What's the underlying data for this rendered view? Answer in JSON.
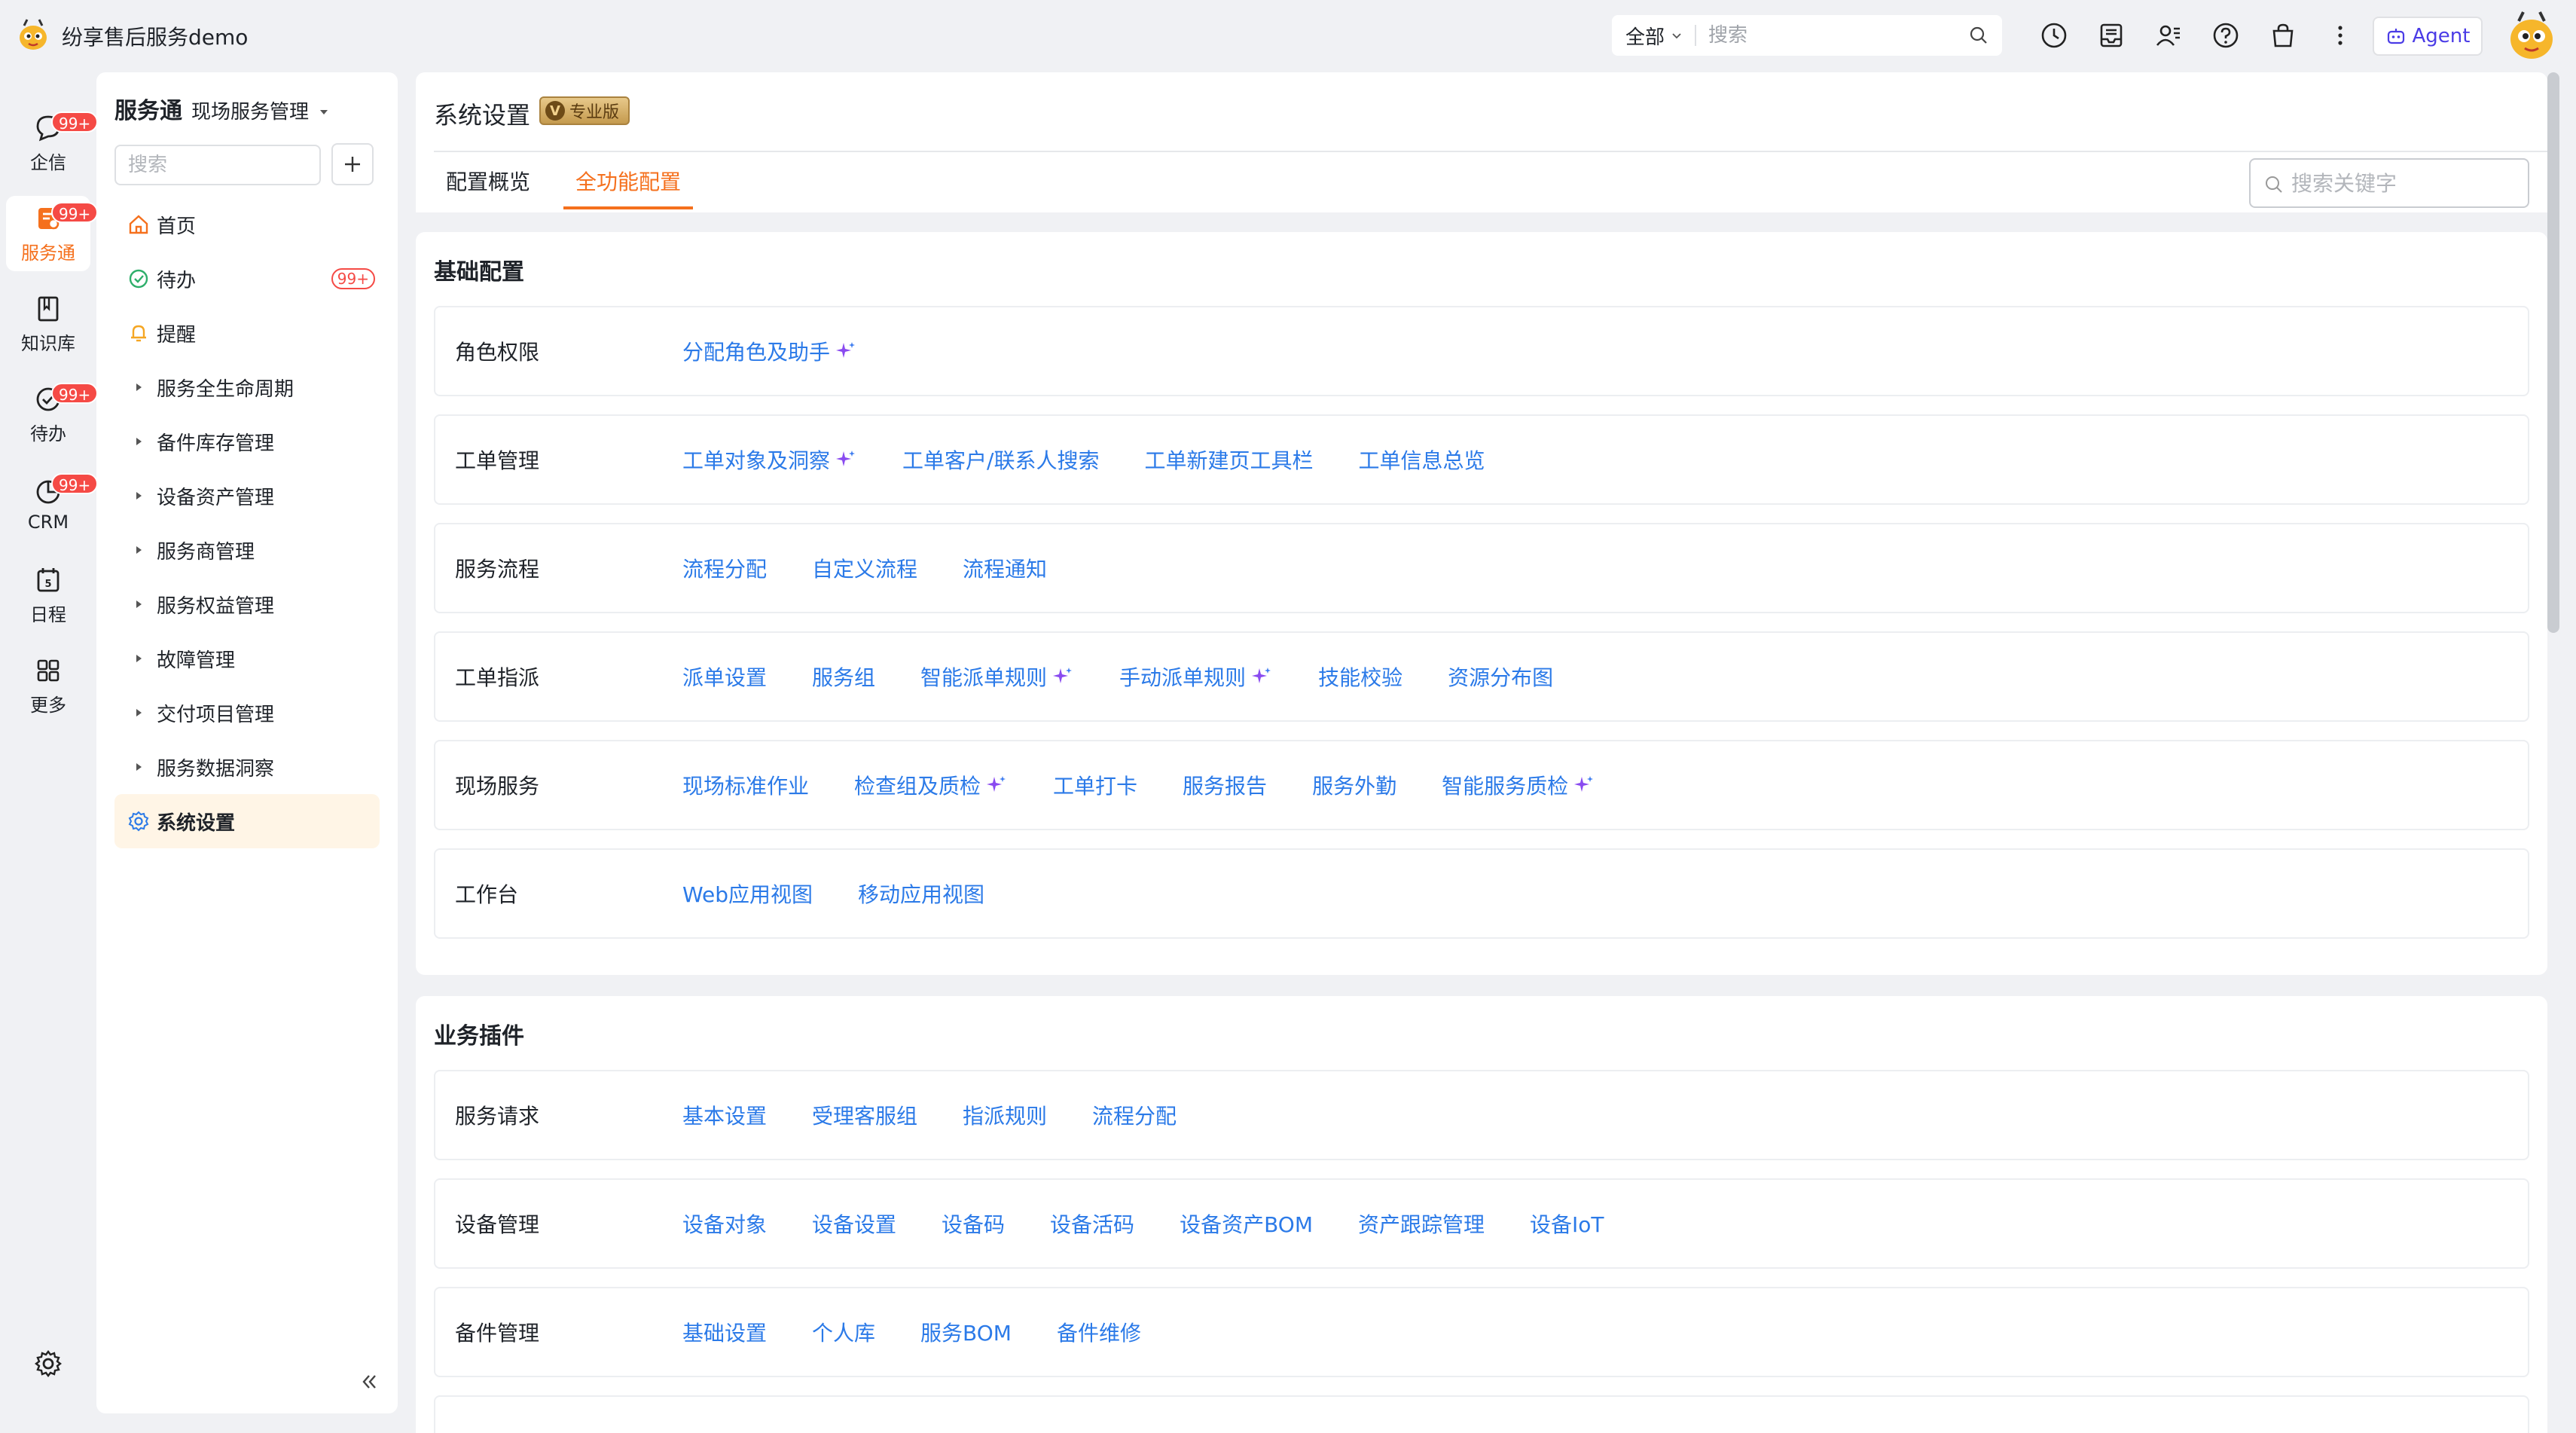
{
  "app": {
    "title": "纷享售后服务demo"
  },
  "topbar": {
    "search_scope": "全部",
    "search_placeholder": "搜索",
    "agent_label": "Agent"
  },
  "rail": {
    "items": [
      {
        "label": "企信",
        "badge": "99+"
      },
      {
        "label": "服务通",
        "badge": "99+"
      },
      {
        "label": "知识库",
        "badge": ""
      },
      {
        "label": "待办",
        "badge": "99+"
      },
      {
        "label": "CRM",
        "badge": "99+"
      },
      {
        "label": "日程",
        "badge": ""
      },
      {
        "label": "更多",
        "badge": ""
      }
    ]
  },
  "nav": {
    "title": "服务通",
    "subtitle": "现场服务管理",
    "search_placeholder": "搜索",
    "items": [
      {
        "label": "首页"
      },
      {
        "label": "待办",
        "badge": "99+"
      },
      {
        "label": "提醒"
      },
      {
        "label": "服务全生命周期"
      },
      {
        "label": "备件库存管理"
      },
      {
        "label": "设备资产管理"
      },
      {
        "label": "服务商管理"
      },
      {
        "label": "服务权益管理"
      },
      {
        "label": "故障管理"
      },
      {
        "label": "交付项目管理"
      },
      {
        "label": "服务数据洞察"
      },
      {
        "label": "系统设置"
      }
    ]
  },
  "main": {
    "title": "系统设置",
    "edition_badge": "专业版",
    "tabs": [
      {
        "label": "配置概览"
      },
      {
        "label": "全功能配置"
      }
    ],
    "keyword_placeholder": "搜索关键字",
    "sections": [
      {
        "title": "基础配置",
        "rows": [
          {
            "label": "角色权限",
            "links": [
              "分配角色及助手"
            ]
          },
          {
            "label": "工单管理",
            "links": [
              "工单对象及洞察",
              "工单客户/联系人搜索",
              "工单新建页工具栏",
              "工单信息总览"
            ]
          },
          {
            "label": "服务流程",
            "links": [
              "流程分配",
              "自定义流程",
              "流程通知"
            ]
          },
          {
            "label": "工单指派",
            "links": [
              "派单设置",
              "服务组",
              "智能派单规则",
              "手动派单规则",
              "技能校验",
              "资源分布图"
            ]
          },
          {
            "label": "现场服务",
            "links": [
              "现场标准作业",
              "检查组及质检",
              "工单打卡",
              "服务报告",
              "服务外勤",
              "智能服务质检"
            ]
          },
          {
            "label": "工作台",
            "links": [
              "Web应用视图",
              "移动应用视图"
            ]
          }
        ]
      },
      {
        "title": "业务插件",
        "rows": [
          {
            "label": "服务请求",
            "links": [
              "基本设置",
              "受理客服组",
              "指派规则",
              "流程分配"
            ]
          },
          {
            "label": "设备管理",
            "links": [
              "设备对象",
              "设备设置",
              "设备码",
              "设备活码",
              "设备资产BOM",
              "资产跟踪管理",
              "设备IoT"
            ]
          },
          {
            "label": "备件管理",
            "links": [
              "基础设置",
              "个人库",
              "服务BOM",
              "备件维修"
            ]
          }
        ]
      }
    ]
  },
  "colors": {
    "accent": "#f5701d",
    "link": "#2b7ae8",
    "badge": "#f54a45",
    "ai_spark": "#8a4bf0"
  }
}
